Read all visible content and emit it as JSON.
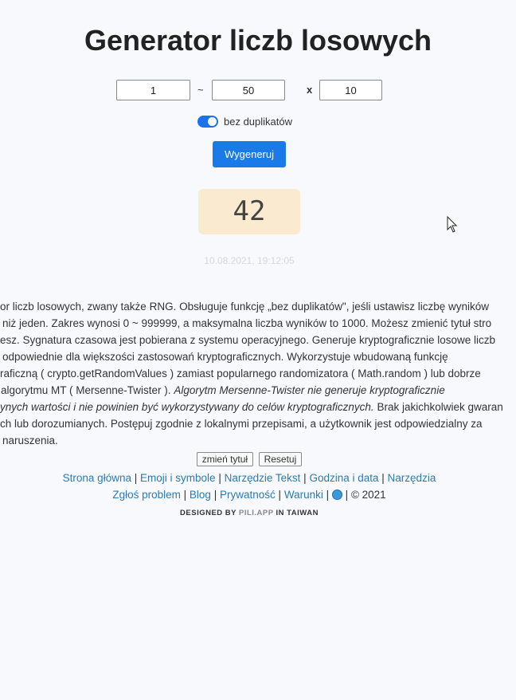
{
  "title": "Generator liczb losowych",
  "inputs": {
    "min": "1",
    "range_sep": "~",
    "max": "50",
    "count_sep": "x",
    "count": "10"
  },
  "options": {
    "no_duplicates_label": "bez duplikatów",
    "no_duplicates_on": true
  },
  "generate_button": "Wygeneruj",
  "result": "42",
  "timestamp": "10.08.2021, 19:12:05",
  "description": {
    "l1": "or liczb losowych, zwany także RNG. Obsługuje funkcję „bez duplikatów\", jeśli ustawisz liczbę wyników",
    "l2": "niż jeden. Zakres wynosi 0 ~ 999999, a maksymalna liczba wyników to 1000. Możesz zmienić tytuł stro",
    "l3": "esz. Sygnatura czasowa jest pobierana z systemu operacyjnego. Generuje kryptograficznie losowe liczb",
    "l4": "odpowiednie dla większości zastosowań kryptograficznych. Wykorzystuje wbudowaną funkcję",
    "l5": "raficzną ( crypto.getRandomValues ) zamiast popularnego randomizatora ( Math.random ) lub dobrze",
    "l6a": "algorytmu MT ( Mersenne-Twister ). ",
    "l6b": "Algorytm Mersenne-Twister nie generuje kryptograficznie",
    "l7a": "ynych wartości i nie powinien być wykorzystywany do celów kryptograficznych.",
    "l7b": " Brak jakichkolwiek gwaran",
    "l8": "ch lub dorozumianych. Postępuj zgodnie z lokalnymi przepisami, a użytkownik jest odpowiedzialny za",
    "l9": "naruszenia."
  },
  "buttons": {
    "change_title": "zmień tytuł",
    "reset": "Resetuj"
  },
  "footer": {
    "links_row1": [
      "Strona główna",
      "Emoji i symbole",
      "Narzędzie Tekst",
      "Godzina i data",
      "Narzędzia"
    ],
    "links_row2": [
      "Zgłoś problem",
      "Blog",
      "Prywatność",
      "Warunki"
    ],
    "copyright": "© 2021",
    "separator": "|",
    "credit_prefix": "DESIGNED BY",
    "credit_brand": "PILI.APP",
    "credit_suffix": "IN TAIWAN"
  },
  "colors": {
    "accent": "#1a7ae8",
    "result_bg": "#faebd0",
    "link": "#2a7ab8"
  },
  "icons": {
    "globe": "globe-icon",
    "cursor": "mouse-cursor-icon"
  }
}
